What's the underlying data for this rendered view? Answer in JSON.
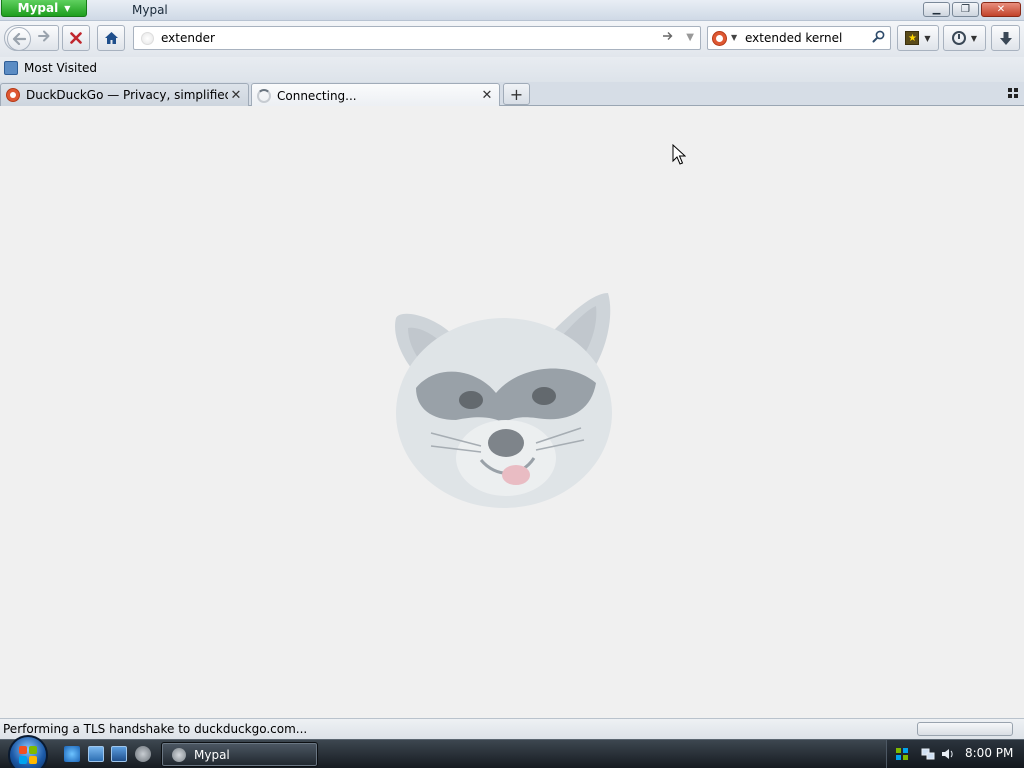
{
  "titlebar": {
    "app_menu_label": "Mypal",
    "window_title": "Mypal"
  },
  "navbar": {
    "url_value": "extender",
    "search_value": "extended kernel"
  },
  "bookmarks": {
    "items": [
      {
        "label": "Most Visited"
      }
    ]
  },
  "tabs": [
    {
      "label": "DuckDuckGo — Privacy, simplified.",
      "icon": "duckduckgo-icon",
      "active": false
    },
    {
      "label": "Connecting...",
      "icon": "loading-spinner-icon",
      "active": true
    }
  ],
  "content": {
    "image": "raccoon-mascot",
    "state": "loading"
  },
  "status": {
    "text": "Performing a TLS handshake to duckduckgo.com..."
  },
  "taskbar": {
    "task_label": "Mypal",
    "clock": "8:00 PM"
  },
  "colors": {
    "app_button": "#1e9e1e",
    "close_button": "#c2432b",
    "page_background": "#f0f0f0",
    "duckduckgo_brand": "#de5833"
  }
}
